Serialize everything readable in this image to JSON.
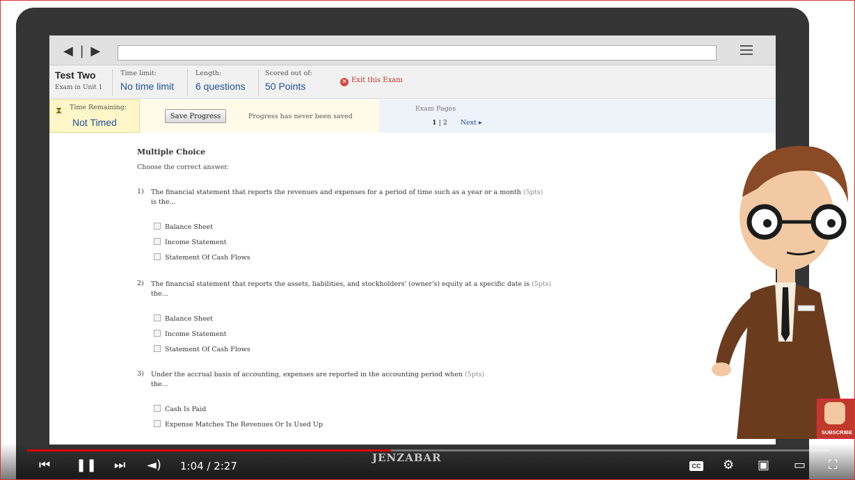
{
  "exam": {
    "title": "Test Two",
    "unit": "Exam in Unit 1",
    "time_limit_label": "Time limit:",
    "time_limit_value": "No time limit",
    "length_label": "Length:",
    "length_value": "6 questions",
    "scored_label": "Scored out of:",
    "scored_value": "50 Points",
    "exit_label": "Exit this Exam"
  },
  "status": {
    "time_remaining_label": "Time Remaining:",
    "time_remaining_value": "Not Timed",
    "save_button_label": "Save Progress",
    "progress_message": "Progress has never been saved",
    "pages_label": "Exam Pages",
    "current_page": "1",
    "page_separator": "|",
    "other_page": "2",
    "next_label": "Next ▸"
  },
  "content": {
    "section_title": "Multiple Choice",
    "instructions": "Choose the correct answer.",
    "questions": [
      {
        "number": "1)",
        "text": "The financial statement that reports the revenues and expenses for a period of time such as a year or a month",
        "points": "(5pts)",
        "text_cont": "is the...",
        "options": [
          "Balance Sheet",
          "Income Statement",
          "Statement Of Cash Flows"
        ]
      },
      {
        "number": "2)",
        "text": "The financial statement that reports the assets, liabilities, and stockholders' (owner's) equity at a specific date is",
        "points": "(5pts)",
        "text_cont": "the...",
        "options": [
          "Balance Sheet",
          "Income Statement",
          "Statement Of Cash Flows"
        ]
      },
      {
        "number": "3)",
        "text": "Under the accrual basis of accounting, expenses are reported in the accounting period when",
        "points": "(5pts)",
        "text_cont": "the...",
        "options": [
          "Cash Is Paid",
          "Expense Matches The Revenues Or Is Used Up"
        ]
      }
    ]
  },
  "player": {
    "time_display": "1:04 / 2:27",
    "progress_fraction": 0.453,
    "watermark": "JENZABAR",
    "cc_label": "CC",
    "subscribe_label": "SUBSCRIBE",
    "played_color": "#e00000"
  },
  "icons": {
    "back_forward": "◀ | ▶",
    "prev": "⏮",
    "pause": "❚❚",
    "next": "⏭",
    "volume": "◄)",
    "settings": "⚙",
    "miniplayer": "▣",
    "theater": "▭",
    "fullscreen": "⛶",
    "hourglass": "⧗",
    "exit_x": "✕"
  }
}
